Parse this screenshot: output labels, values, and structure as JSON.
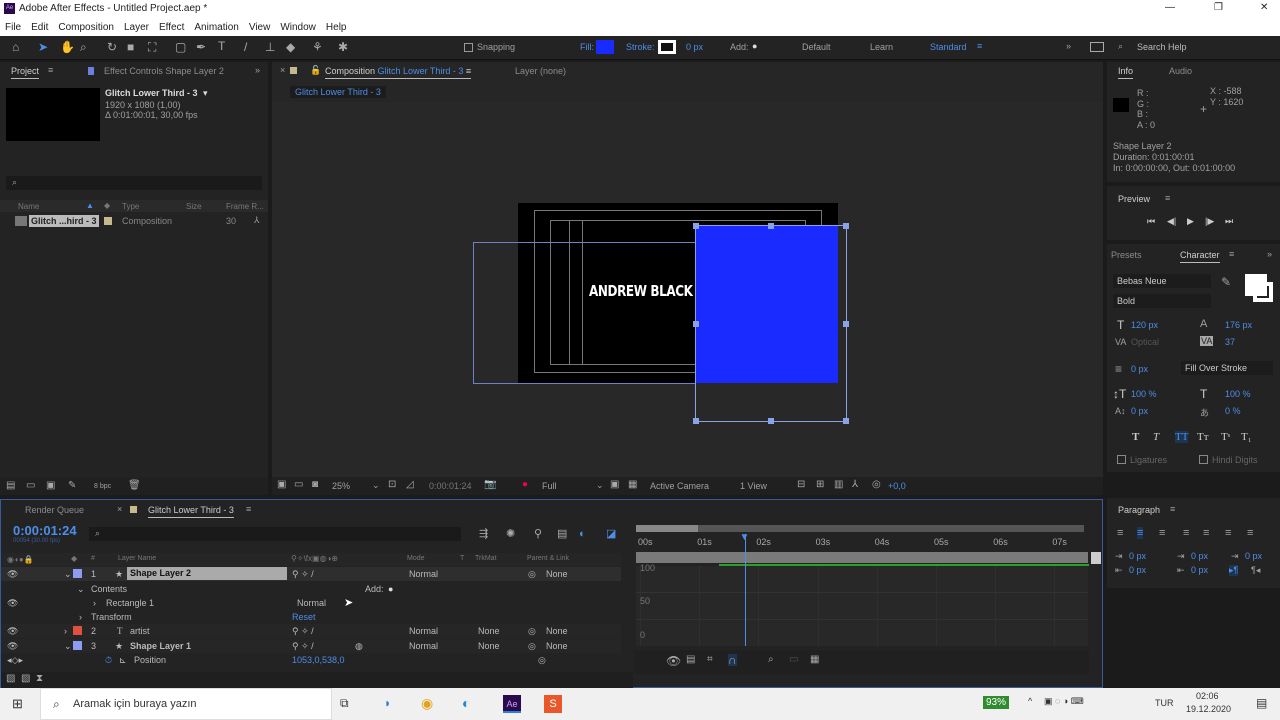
{
  "window": {
    "title": "Adobe After Effects - Untitled Project.aep *",
    "controls": [
      "—",
      "❐",
      "✕"
    ]
  },
  "menu": [
    "File",
    "Edit",
    "Composition",
    "Layer",
    "Effect",
    "Animation",
    "View",
    "Window",
    "Help"
  ],
  "toolbar": {
    "snapping": "Snapping",
    "fill": "Fill:",
    "stroke": "Stroke:",
    "stroke_width": "0 px",
    "add": "Add:",
    "workspaces": [
      "Default",
      "Learn",
      "Standard"
    ],
    "active_workspace": "Standard",
    "search_help": "Search Help",
    "fill_color": "#1a2bff"
  },
  "project": {
    "tab": "Project",
    "effect_controls_tab": "Effect Controls Shape Layer 2",
    "comp_name": "Glitch Lower Third - 3",
    "comp_size": "1920 x 1080 (1,00)",
    "comp_duration": "Δ 0:01:00:01, 30,00 fps",
    "columns": [
      "Name",
      "Type",
      "Size",
      "Frame R..."
    ],
    "items": [
      {
        "name": "Glitch ...hird - 3",
        "type": "Composition",
        "frame_rate": "30"
      }
    ],
    "bpc": "8 bpc"
  },
  "composition": {
    "tab_prefix": "Composition",
    "tab_name": "Glitch Lower Third - 3",
    "layer_tab": "Layer (none)",
    "breadcrumb": "Glitch Lower Third - 3",
    "text": "ANDREW BLACK",
    "shape_color": "#1a2bff",
    "zoom": "25%",
    "timecode": "0:00:01:24",
    "resolution": "Full",
    "camera": "Active Camera",
    "views": "1 View",
    "exposure": "+0,0"
  },
  "info": {
    "tab": "Info",
    "audio_tab": "Audio",
    "r": "R :",
    "g": "G :",
    "b": "B :",
    "a": "A : 0",
    "x": "X : -588",
    "y": "Y : 1620",
    "layer": "Shape Layer 2",
    "duration": "Duration: 0:01:00:01",
    "inout": "In: 0:00:00:00, Out: 0:01:00:00"
  },
  "preview": {
    "tab": "Preview"
  },
  "character": {
    "presets_tab": "Presets",
    "tab": "Character",
    "font": "Bebas Neue",
    "style": "Bold",
    "size": "120 px",
    "leading": "176 px",
    "kerning": "Optical",
    "tracking": "37",
    "stroke_width": "0 px",
    "stroke_mode": "Fill Over Stroke",
    "vscale": "100 %",
    "hscale": "100 %",
    "baseline": "0 px",
    "tsume": "0 %",
    "ligatures": "Ligatures",
    "hindi": "Hindi Digits"
  },
  "paragraph": {
    "tab": "Paragraph",
    "indent": [
      "0 px",
      "0 px",
      "0 px",
      "0 px",
      "0 px"
    ]
  },
  "timeline": {
    "render_queue": "Render Queue",
    "tab": "Glitch Lower Third - 3",
    "timecode": "0:00:01:24",
    "frames": "00054 (30.00 fps)",
    "columns": {
      "num": "#",
      "name": "Layer Name",
      "mode": "Mode",
      "t": "T",
      "trkmat": "TrkMat",
      "parent": "Parent & Link"
    },
    "rows": [
      {
        "num": "1",
        "name": "Shape Layer 2",
        "mode": "Normal",
        "trkmat": "",
        "parent": "None",
        "color": "#8c9cf0",
        "icon": "★"
      },
      {
        "name": "Contents",
        "add": "Add:"
      },
      {
        "name": "Rectangle 1",
        "mode": "Normal"
      },
      {
        "name": "Transform",
        "reset": "Reset"
      },
      {
        "num": "2",
        "name": "artist",
        "mode": "Normal",
        "trkmat": "None",
        "parent": "None",
        "color": "#e05040",
        "icon": "T"
      },
      {
        "num": "3",
        "name": "Shape Layer 1",
        "mode": "Normal",
        "trkmat": "None",
        "parent": "None",
        "color": "#8c9cf0",
        "icon": "★"
      },
      {
        "name": "Position",
        "value": "1053,0,538,0"
      }
    ],
    "ruler": [
      "00s",
      "01s",
      "02s",
      "03s",
      "04s",
      "05s",
      "06s",
      "07s"
    ],
    "graph_labels": [
      "100",
      "50",
      "0"
    ],
    "playhead_seconds": 1.8
  },
  "taskbar": {
    "search": "Aramak için buraya yazın",
    "battery": "93%",
    "lang": "TUR",
    "time": "02:06",
    "date": "19.12.2020"
  }
}
